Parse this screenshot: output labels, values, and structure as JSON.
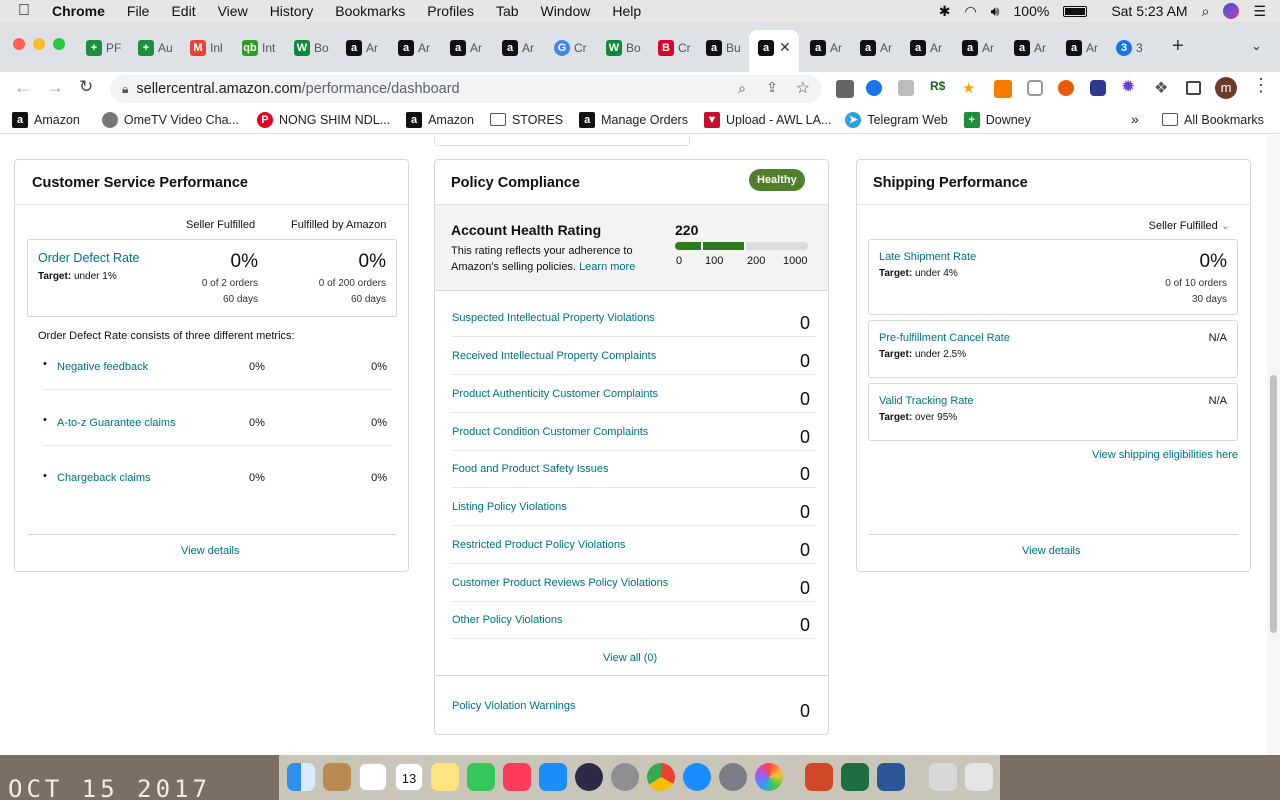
{
  "menubar": {
    "app": "Chrome",
    "items": [
      "File",
      "Edit",
      "View",
      "History",
      "Bookmarks",
      "Profiles",
      "Tab",
      "Window",
      "Help"
    ],
    "battery": "100%",
    "clock": "Sat 5:23 AM"
  },
  "tabs": [
    {
      "icon": "sheets",
      "label": "PF"
    },
    {
      "icon": "sheets",
      "label": "Au"
    },
    {
      "icon": "gmail",
      "label": "Inl"
    },
    {
      "icon": "qb",
      "label": "Int"
    },
    {
      "icon": "w",
      "label": "Bo"
    },
    {
      "icon": "amazon",
      "label": "Ar"
    },
    {
      "icon": "amazon",
      "label": "Ar"
    },
    {
      "icon": "amazon",
      "label": "Ar"
    },
    {
      "icon": "amazon",
      "label": "Ar"
    },
    {
      "icon": "google",
      "label": "Cr"
    },
    {
      "icon": "w",
      "label": "Bo"
    },
    {
      "icon": "b",
      "label": "Cr"
    },
    {
      "icon": "amazon",
      "label": "Bu"
    },
    {
      "icon": "amazon",
      "label": ""
    },
    {
      "icon": "amazon",
      "label": "Ar"
    },
    {
      "icon": "amazon",
      "label": "Ar"
    },
    {
      "icon": "amazon",
      "label": "Ar"
    },
    {
      "icon": "amazon",
      "label": "Ar"
    },
    {
      "icon": "amazon",
      "label": "Ar"
    },
    {
      "icon": "amazon",
      "label": "Ar"
    },
    {
      "icon": "3",
      "label": "3"
    }
  ],
  "address": {
    "host": "sellercentral.amazon.com",
    "path": "/performance/dashboard"
  },
  "profile_initial": "m",
  "bookmarks": [
    "Amazon",
    "OmeTV Video Cha...",
    "NONG SHIM NDL...",
    "Amazon",
    "STORES",
    "Manage Orders",
    "Upload - AWL LA...",
    "Telegram Web",
    "Downey"
  ],
  "bookmarks_more": "»",
  "all_bookmarks": "All Bookmarks",
  "csp": {
    "title": "Customer Service Performance",
    "col_seller": "Seller Fulfilled",
    "col_fba": "Fulfilled by Amazon",
    "odr": {
      "label": "Order Defect Rate",
      "target_prefix": "Target:",
      "target": "under 1%",
      "seller_val": "0%",
      "seller_orders": "0 of 2 orders",
      "seller_days": "60 days",
      "fba_val": "0%",
      "fba_orders": "0 of 200 orders",
      "fba_days": "60 days"
    },
    "consists": "Order Defect Rate consists of three different metrics:",
    "metrics": [
      {
        "label": "Negative feedback",
        "seller": "0%",
        "fba": "0%"
      },
      {
        "label": "A-to-z Guarantee claims",
        "seller": "0%",
        "fba": "0%"
      },
      {
        "label": "Chargeback claims",
        "seller": "0%",
        "fba": "0%"
      }
    ],
    "view_details": "View details"
  },
  "policy": {
    "title": "Policy Compliance",
    "badge": "Healthy",
    "ahr_title": "Account Health Rating",
    "ahr_value": "220",
    "ahr_desc": "This rating reflects your adherence to Amazon's selling policies.",
    "learn_more": "Learn more",
    "scale": [
      "0",
      "100",
      "200",
      "1000"
    ],
    "rows": [
      {
        "label": "Suspected Intellectual Property Violations",
        "value": "0"
      },
      {
        "label": "Received Intellectual Property Complaints",
        "value": "0"
      },
      {
        "label": "Product Authenticity Customer Complaints",
        "value": "0"
      },
      {
        "label": "Product Condition Customer Complaints",
        "value": "0"
      },
      {
        "label": "Food and Product Safety Issues",
        "value": "0"
      },
      {
        "label": "Listing Policy Violations",
        "value": "0"
      },
      {
        "label": "Restricted Product Policy Violations",
        "value": "0"
      },
      {
        "label": "Customer Product Reviews Policy Violations",
        "value": "0"
      },
      {
        "label": "Other Policy Violations",
        "value": "0"
      }
    ],
    "view_all": "View all (0)",
    "warnings": {
      "label": "Policy Violation Warnings",
      "value": "0"
    },
    "colors": {
      "good": "#2e7d1c",
      "badge": "#4f7f2a"
    }
  },
  "shipping": {
    "title": "Shipping Performance",
    "dropdown": "Seller Fulfilled",
    "late": {
      "label": "Late Shipment Rate",
      "target_prefix": "Target:",
      "target": "under 4%",
      "value": "0%",
      "orders": "0 of 10 orders",
      "days": "30 days"
    },
    "cancel": {
      "label": "Pre-fulfillment Cancel Rate",
      "target_prefix": "Target:",
      "target": "under 2.5%",
      "value": "N/A"
    },
    "tracking": {
      "label": "Valid Tracking Rate",
      "target_prefix": "Target:",
      "target": "over 95%",
      "value": "N/A"
    },
    "eligibility": "View shipping eligibilities here",
    "view_details": "View details"
  },
  "desktop_text": "OCT 15 2017"
}
